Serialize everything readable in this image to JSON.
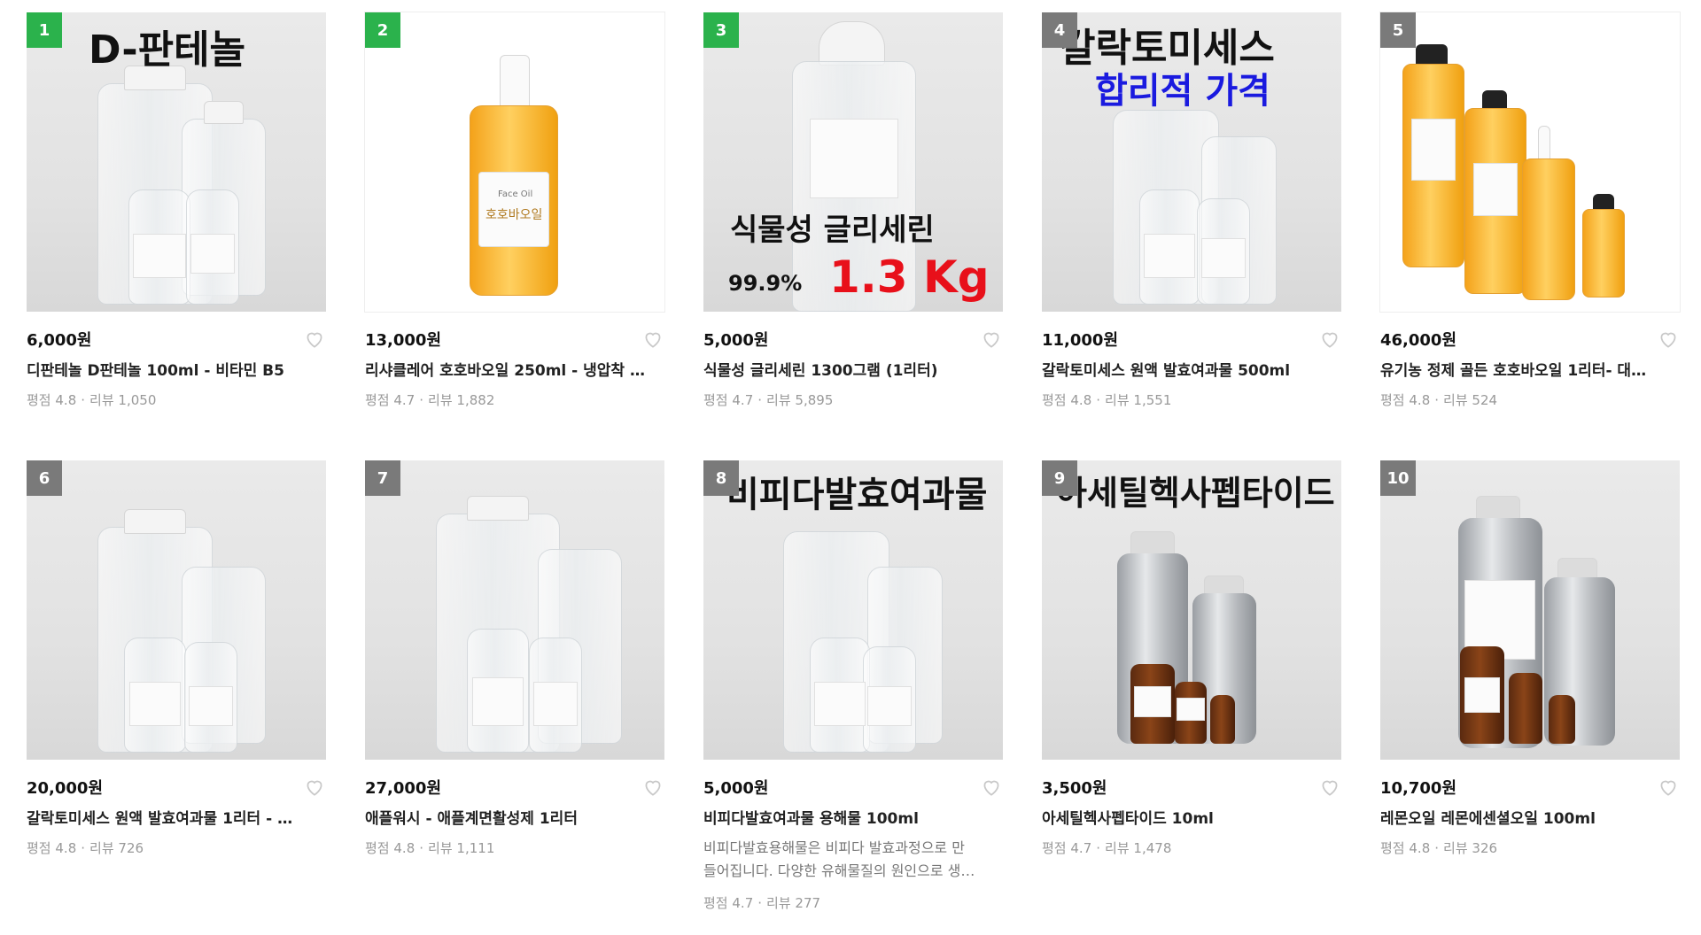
{
  "accent_color": "#2bb24c",
  "rank_gray_color": "#7a7a7a",
  "rating_label": "평점",
  "review_label": "리뷰",
  "separator": "·",
  "products": [
    {
      "rank": "1",
      "price": "6,000원",
      "title": "디판테놀 D판테놀 100ml - 비타민 B5",
      "rating": "4.8",
      "reviews": "1,050",
      "overlay": [
        "D-판테놀"
      ]
    },
    {
      "rank": "2",
      "price": "13,000원",
      "title": "리샤클레어 호호바오일 250ml - 냉압착 …",
      "rating": "4.7",
      "reviews": "1,882",
      "overlay": [
        "Face Oil",
        "호호바오일"
      ]
    },
    {
      "rank": "3",
      "price": "5,000원",
      "title": "식물성 글리세린 1300그램 (1리터)",
      "rating": "4.7",
      "reviews": "5,895",
      "overlay": [
        "식물성  글리세린",
        "99.9%",
        "1.3 Kg"
      ]
    },
    {
      "rank": "4",
      "price": "11,000원",
      "title": "갈락토미세스 원액 발효여과물 500ml",
      "rating": "4.8",
      "reviews": "1,551",
      "overlay": [
        "갈락토미세스",
        "합리적 가격"
      ]
    },
    {
      "rank": "5",
      "price": "46,000원",
      "title": "유기농 정제 골든 호호바오일 1리터- 대…",
      "rating": "4.8",
      "reviews": "524",
      "overlay": []
    },
    {
      "rank": "6",
      "price": "20,000원",
      "title": "갈락토미세스 원액 발효여과물 1리터 - …",
      "rating": "4.8",
      "reviews": "726",
      "overlay": []
    },
    {
      "rank": "7",
      "price": "27,000원",
      "title": "애플워시 - 애플계면활성제 1리터",
      "rating": "4.8",
      "reviews": "1,111",
      "overlay": []
    },
    {
      "rank": "8",
      "price": "5,000원",
      "title": "비피다발효여과물 용해물 100ml",
      "desc1": "비피다발효용해물은 비피다 발효과정으로 만",
      "desc2": "들어집니다. 다양한 유해물질의 원인으로 생…",
      "rating": "4.7",
      "reviews": "277",
      "overlay": [
        "비피다발효여과물"
      ]
    },
    {
      "rank": "9",
      "price": "3,500원",
      "title": "아세틸헥사펩타이드 10ml",
      "rating": "4.7",
      "reviews": "1,478",
      "overlay": [
        "아세틸헥사펩타이드"
      ]
    },
    {
      "rank": "10",
      "price": "10,700원",
      "title": "레몬오일 레몬에센셜오일 100ml",
      "rating": "4.8",
      "reviews": "326",
      "overlay": []
    }
  ]
}
